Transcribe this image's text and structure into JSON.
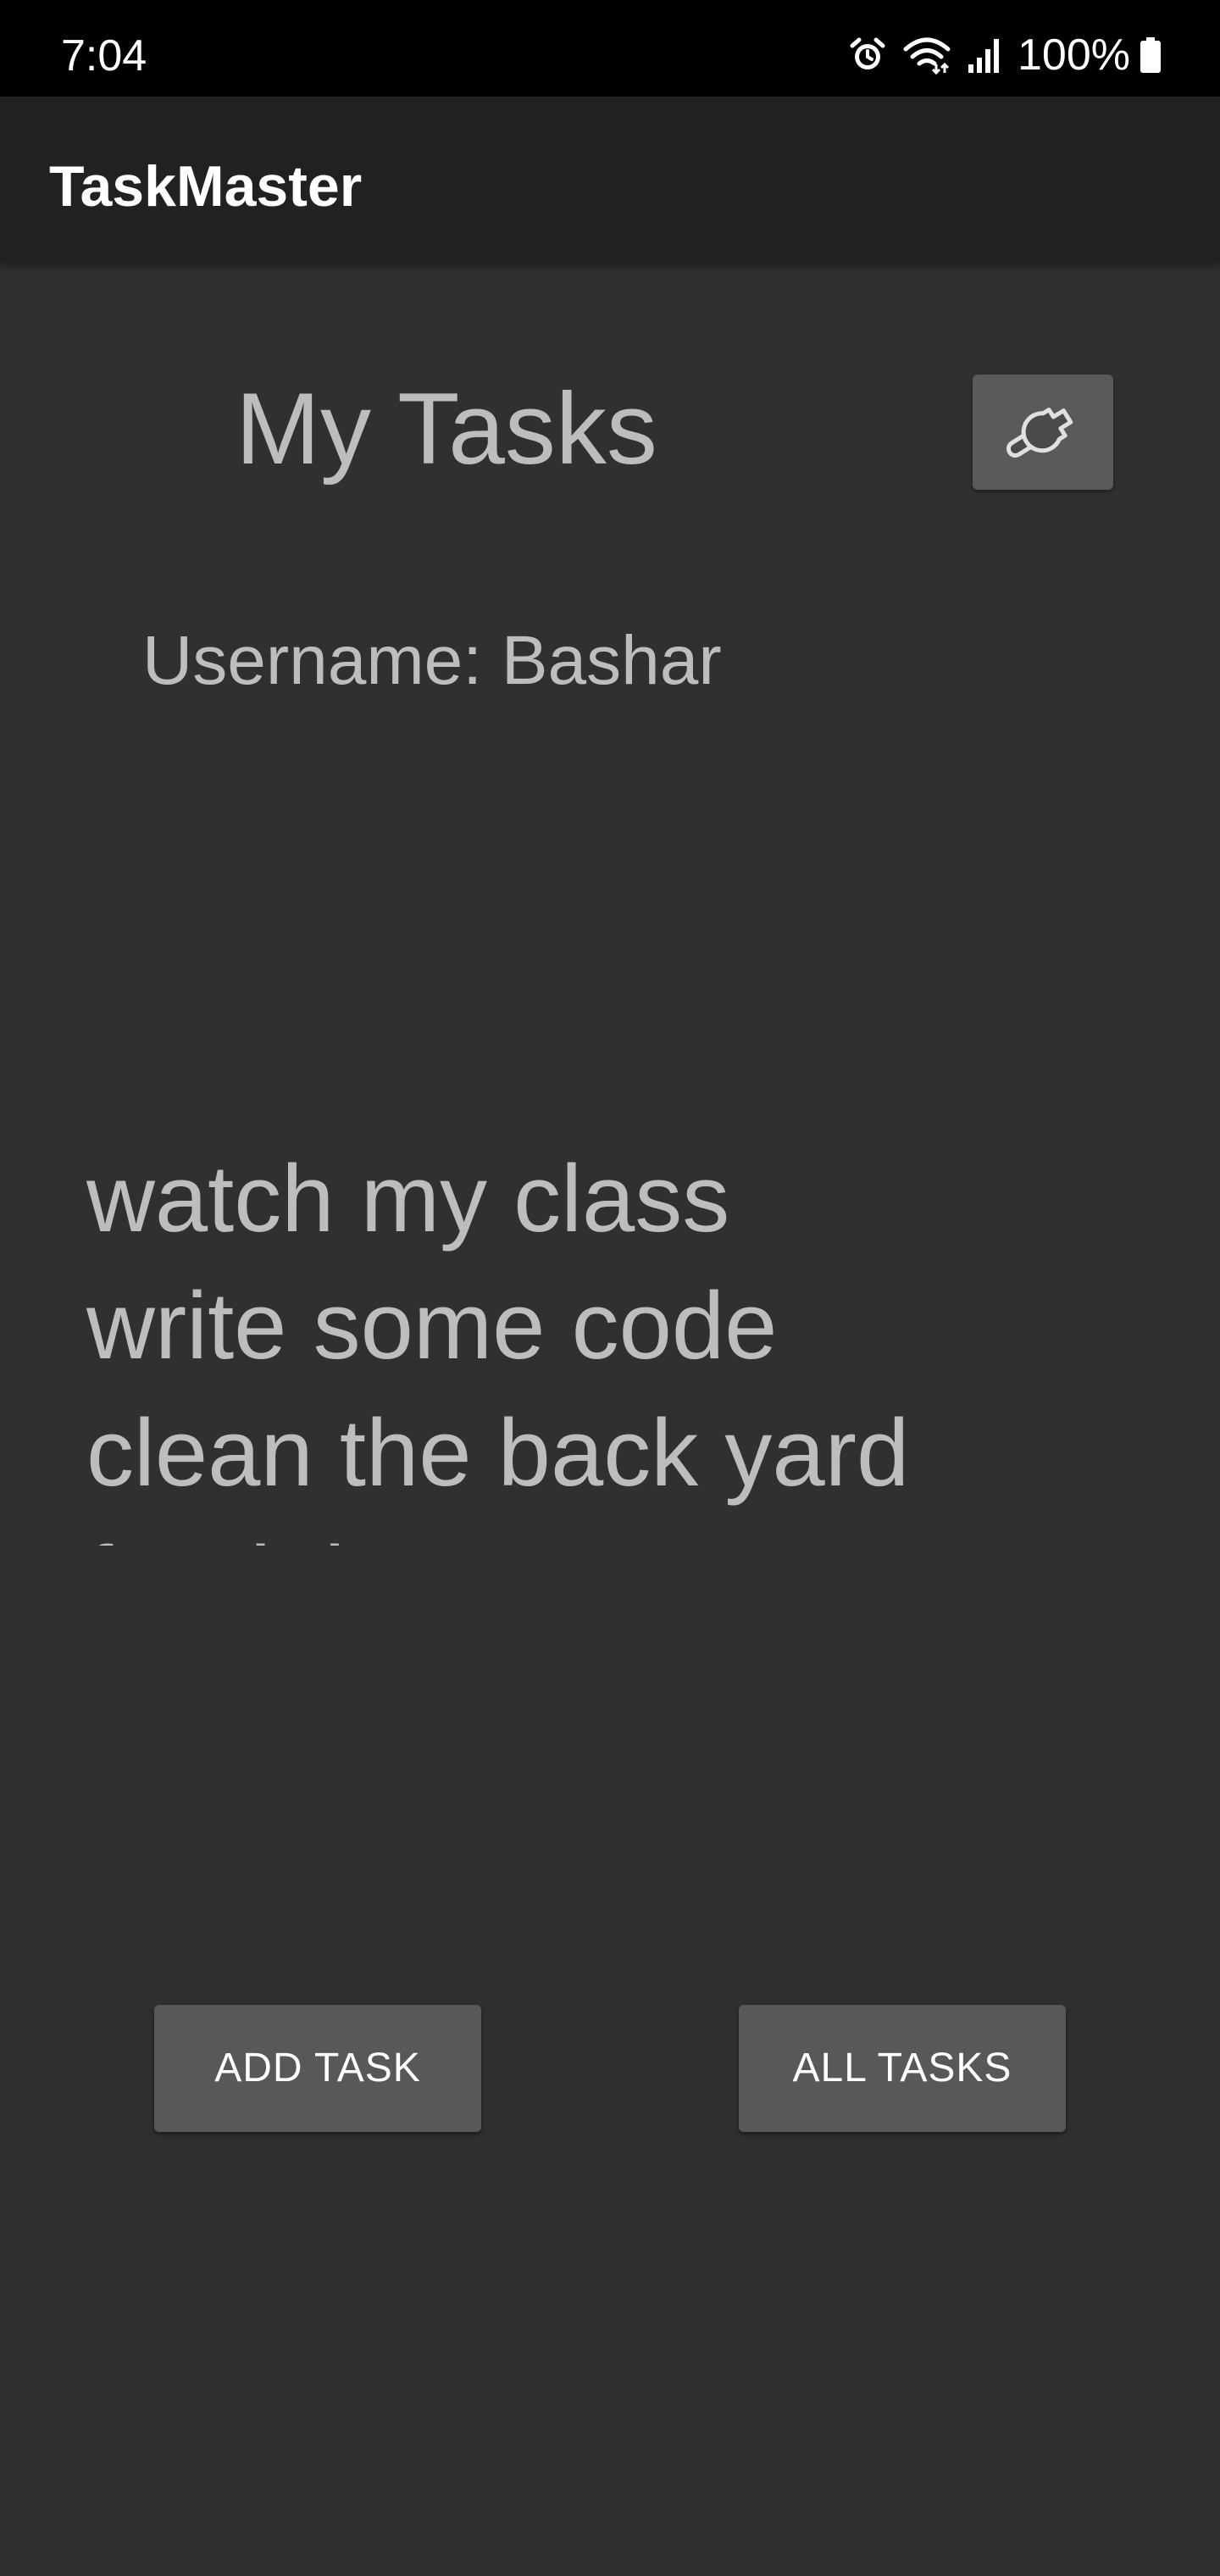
{
  "status_bar": {
    "time": "7:04",
    "battery": "100%",
    "icons": [
      "alarm-icon",
      "wifi-icon",
      "signal-icon",
      "battery-icon"
    ]
  },
  "app_bar": {
    "title": "TaskMaster"
  },
  "main": {
    "title": "My Tasks",
    "settings_icon": "wrench-icon",
    "username": "Username: Bashar",
    "tasks": [
      "watch my class",
      "write some code",
      "clean the back yard",
      "feed the"
    ],
    "add_task_label": "ADD TASK",
    "all_tasks_label": "ALL TASKS"
  },
  "colors": {
    "background": "#303030",
    "app_bar": "#212121",
    "button": "#585858",
    "text_muted": "#bdbdbd",
    "text_white": "#ffffff"
  }
}
